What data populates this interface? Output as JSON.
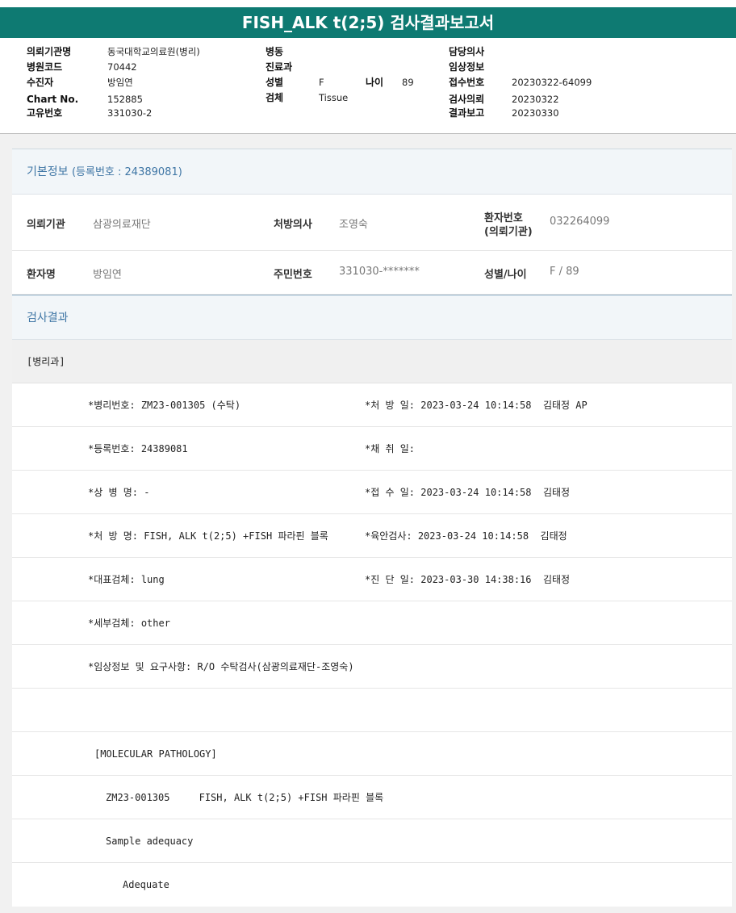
{
  "report": {
    "title": "FISH_ALK t(2;5) 검사결과보고서"
  },
  "header_fields": {
    "hospital": {
      "label": "의뢰기관명",
      "value": "동국대학교의료원(병리)"
    },
    "code": {
      "label": "병원코드",
      "value": "70442"
    },
    "patient": {
      "label": "수진자",
      "value": "방임연"
    },
    "chart": {
      "label": "Chart No.",
      "value": "152885"
    },
    "unique": {
      "label": "고유번호",
      "value": "331030-2"
    },
    "ward": {
      "label": "병동",
      "value": ""
    },
    "dept": {
      "label": "진료과",
      "value": ""
    },
    "sex": {
      "label": "성별",
      "value": "F"
    },
    "age": {
      "label": "나이",
      "value": "89"
    },
    "specimen": {
      "label": "검체",
      "value": "Tissue"
    },
    "doctor": {
      "label": "담당의사",
      "value": ""
    },
    "clinical": {
      "label": "임상정보",
      "value": ""
    },
    "receipt_no": {
      "label": "접수번호",
      "value": "20230322-64099"
    },
    "request": {
      "label": "검사의뢰",
      "value": "20230322"
    },
    "result_report": {
      "label": "결과보고",
      "value": "20230330"
    }
  },
  "basic_info": {
    "heading": "기본정보",
    "reg_note": "(등록번호 : 24389081)",
    "req_org": {
      "label": "의뢰기관",
      "value": "삼광의료재단"
    },
    "prescriber": {
      "label": "처방의사",
      "value": "조영숙"
    },
    "patient_no": {
      "label_line1": "환자번호",
      "label_line2": "(의뢰기관)",
      "value": "032264099"
    },
    "patient_name": {
      "label": "환자명",
      "value": "방임연"
    },
    "resident_no": {
      "label": "주민번호",
      "value": "331030-*******"
    },
    "sex_age": {
      "label": "성별/나이",
      "value": "F / 89"
    }
  },
  "results": {
    "heading": "검사결과",
    "department": "[병리과]",
    "rows": [
      {
        "left": "*병리번호: ZM23-001305 (수탁)",
        "right": "*처 방 일: 2023-03-24 10:14:58  김태정 AP"
      },
      {
        "left": "*등록번호: 24389081",
        "right": "*채 취 일:"
      },
      {
        "left": "*상 병 명: -",
        "right": "*접 수 일: 2023-03-24 10:14:58  김태정"
      },
      {
        "left": "*처 방 명: FISH, ALK t(2;5) +FISH 파라핀 블록",
        "right": "*육안검사: 2023-03-24 10:14:58  김태정"
      },
      {
        "left": "*대표검체: lung",
        "right": "*진 단 일: 2023-03-30 14:38:16  김태정"
      },
      {
        "left": "*세부검체: other",
        "right": ""
      },
      {
        "left": "*임상정보 및 요구사항: R/O 수탁검사(삼광의료재단-조영숙)",
        "right": ""
      }
    ],
    "molecular_heading": "[MOLECULAR PATHOLOGY]",
    "molecular_line": "ZM23-001305     FISH, ALK t(2;5) +FISH 파라핀 블록",
    "adequacy_label": "Sample adequacy",
    "adequacy_value": "Adequate"
  }
}
